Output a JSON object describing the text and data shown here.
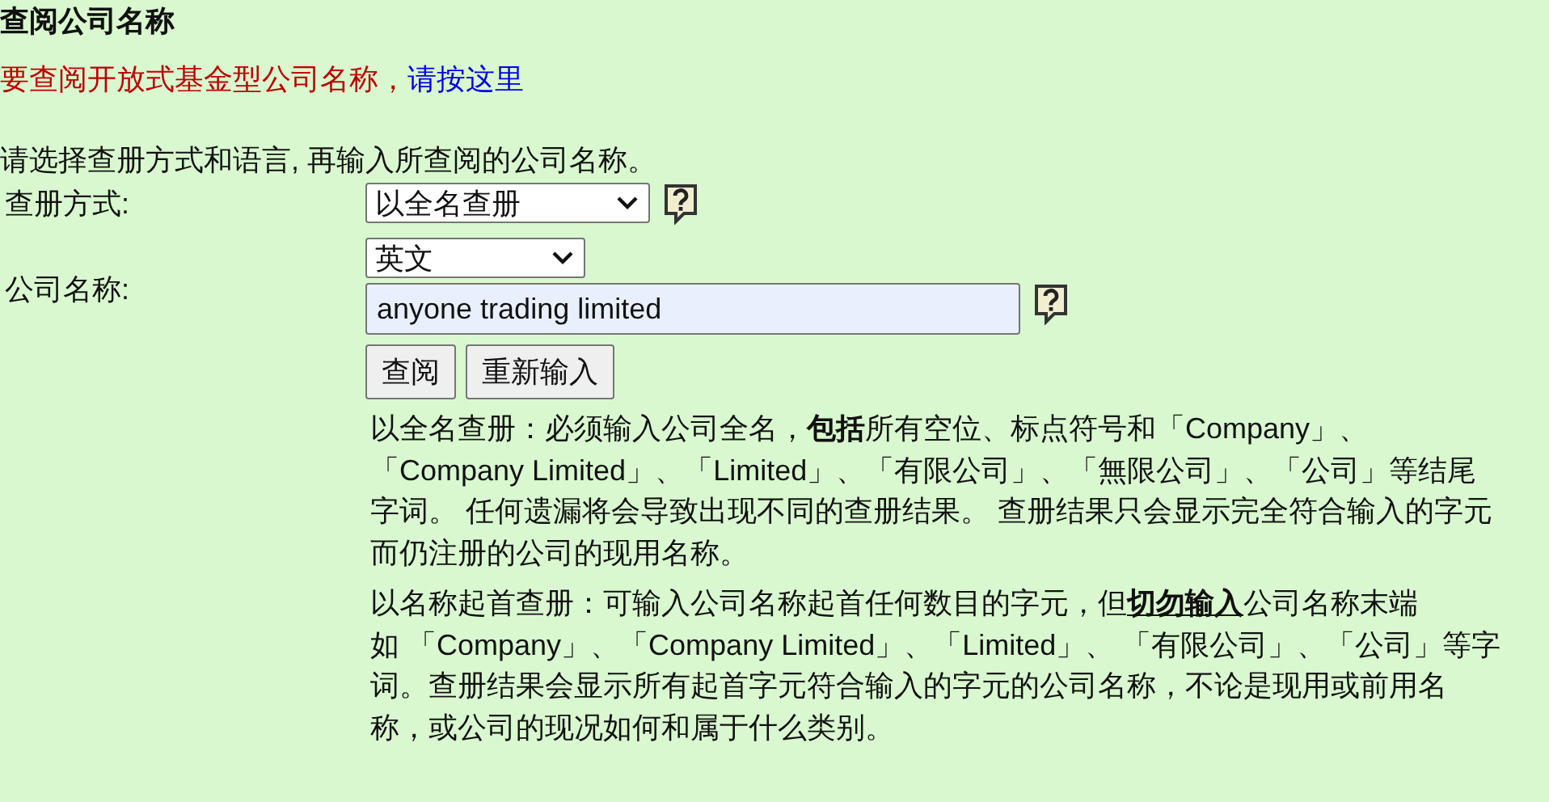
{
  "title": "查阅公司名称",
  "notice": {
    "text": "要查阅开放式基金型公司名称，",
    "link": "请按这里"
  },
  "instruction": "请选择查册方式和语言, 再输入所查阅的公司名称。",
  "form": {
    "search_method": {
      "label": "查册方式:",
      "value": "以全名查册"
    },
    "company_name": {
      "label": "公司名称:",
      "language": "英文",
      "value": "anyone trading limited"
    },
    "buttons": [
      "查阅",
      "重新输入"
    ]
  },
  "notes": [
    [
      {
        "kind": "plain",
        "text": "以全名查册：必须输入公司全名，"
      },
      {
        "kind": "bold",
        "text": "包括"
      },
      {
        "kind": "plain",
        "text": "所有空位、标点符号和「Company」、「Company Limited」、「Limited」、「有限公司」、「無限公司」、「公司」等结尾字词。 任何遗漏将会导致出现不同的查册结果。 查册结果只会显示完全符合输入的字元而仍注册的公司的现用名称。"
      }
    ],
    [
      {
        "kind": "plain",
        "text": "以名称起首查册：可输入公司名称起首任何数目的字元，但"
      },
      {
        "kind": "bold-underline",
        "text": "切勿输入"
      },
      {
        "kind": "plain",
        "text": "公司名称末端"
      },
      {
        "kind": "nowrap",
        "text": "如 「Company」"
      },
      {
        "kind": "plain",
        "text": "、「Company Limited」、「Limited」、 「有限公司」、「公司」等字词。查册结果会显示所有起首字元符合输入的字元的公司名称，不论是现用或前用名称，或公司的现况如何和属于什么类别。"
      }
    ]
  ]
}
